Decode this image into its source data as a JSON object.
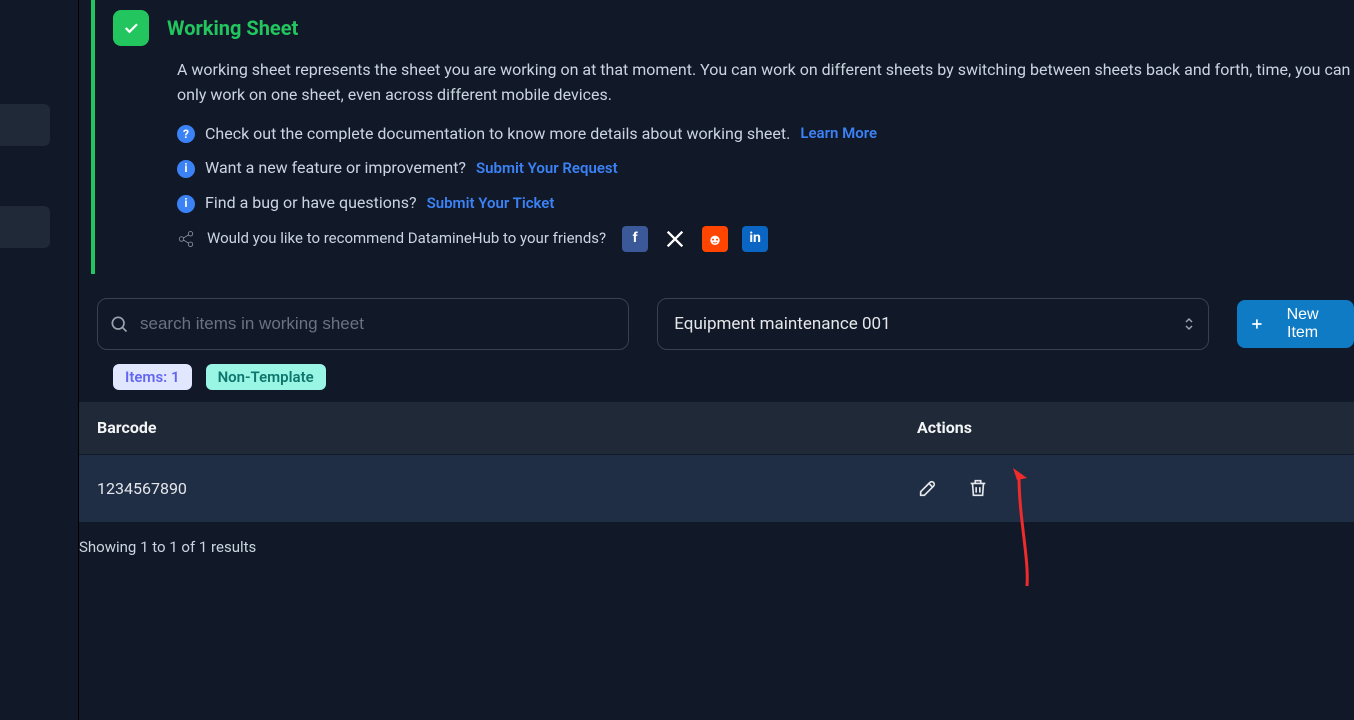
{
  "card": {
    "title": "Working Sheet",
    "description": "A working sheet represents the sheet you are working on at that moment. You can work on different sheets by switching between sheets back and forth, time, you can only work on one sheet, even across different mobile devices.",
    "rows": {
      "docs_text": "Check out the complete documentation to know more details about working sheet.",
      "docs_link": "Learn More",
      "feature_text": "Want a new feature or improvement?",
      "feature_link": "Submit Your Request",
      "bug_text": "Find a bug or have questions?",
      "bug_link": "Submit Your Ticket",
      "share_text": "Would you like to recommend DatamineHub to your friends?"
    }
  },
  "toolbar": {
    "search_placeholder": "search items in working sheet",
    "sheet_selected": "Equipment maintenance 001",
    "new_item_label": "New Item"
  },
  "badges": {
    "items": "Items: 1",
    "template": "Non-Template"
  },
  "table": {
    "head_barcode": "Barcode",
    "head_actions": "Actions",
    "rows": [
      {
        "barcode": "1234567890"
      }
    ]
  },
  "pager": "Showing 1 to 1 of 1 results"
}
